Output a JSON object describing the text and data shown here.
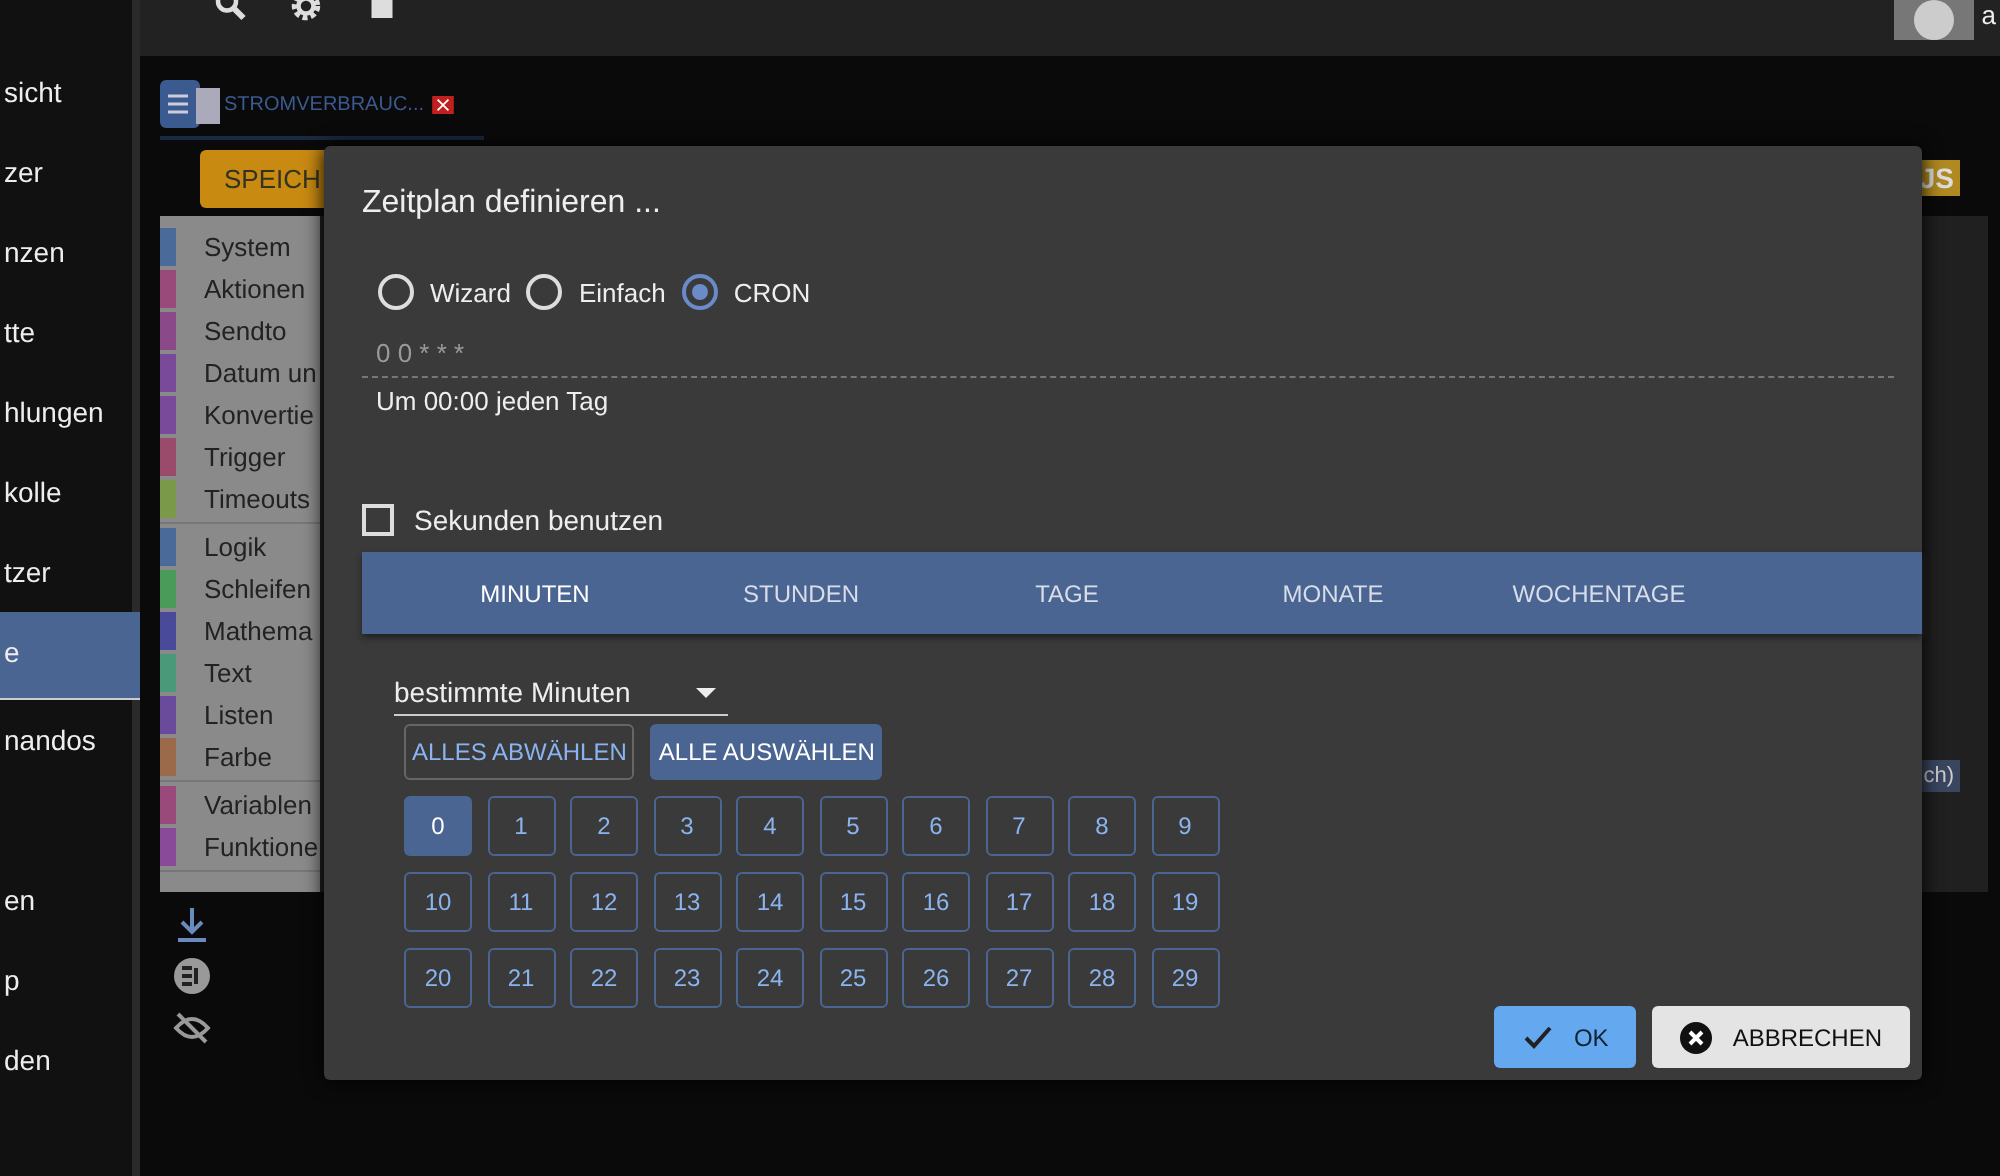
{
  "sidebar": {
    "items": [
      {
        "label": "sicht",
        "selected": false
      },
      {
        "label": "zer",
        "selected": false
      },
      {
        "label": "nzen",
        "selected": false
      },
      {
        "label": "tte",
        "selected": false
      },
      {
        "label": "hlungen",
        "selected": false
      },
      {
        "label": "kolle",
        "selected": false
      },
      {
        "label": "tzer",
        "selected": false
      },
      {
        "label": "e",
        "selected": true
      },
      {
        "label": "nandos",
        "selected": false
      },
      {
        "label": "en",
        "selected": false
      },
      {
        "label": "p",
        "selected": false
      },
      {
        "label": "den",
        "selected": false
      }
    ]
  },
  "user": {
    "name": "a"
  },
  "editor": {
    "tab_title": "STROMVERBRAUC...",
    "save_button": "SPEICH",
    "js_badge": "JS",
    "block_fragment": "ch)",
    "toolbox": [
      [
        {
          "label": "System",
          "color": "#4a6a9a"
        },
        {
          "label": "Aktionen",
          "color": "#9a4a7a"
        },
        {
          "label": "Sendto",
          "color": "#8a4a8a"
        },
        {
          "label": "Datum un",
          "color": "#7a4a9a"
        },
        {
          "label": "Konvertie",
          "color": "#7a4a9a"
        },
        {
          "label": "Trigger",
          "color": "#9a4a6a"
        },
        {
          "label": "Timeouts",
          "color": "#7a9a4a"
        }
      ],
      [
        {
          "label": "Logik",
          "color": "#4a6a9a"
        },
        {
          "label": "Schleifen",
          "color": "#4a9a5a"
        },
        {
          "label": "Mathema",
          "color": "#4a4a9a"
        },
        {
          "label": "Text",
          "color": "#4a9a7a"
        },
        {
          "label": "Listen",
          "color": "#6a4a9a"
        },
        {
          "label": "Farbe",
          "color": "#9a6a4a"
        }
      ],
      [
        {
          "label": "Variablen",
          "color": "#9a4a7a"
        },
        {
          "label": "Funktione",
          "color": "#8a4a9a"
        }
      ]
    ]
  },
  "dialog": {
    "title": "Zeitplan definieren ...",
    "modes": [
      {
        "label": "Wizard",
        "selected": false
      },
      {
        "label": "Einfach",
        "selected": false
      },
      {
        "label": "CRON",
        "selected": true
      }
    ],
    "cron_value": "0 0 * * *",
    "description": "Um 00:00 jeden Tag",
    "use_seconds": {
      "label": "Sekunden benutzen",
      "checked": false
    },
    "tabs": [
      {
        "label": "MINUTEN",
        "selected": true
      },
      {
        "label": "STUNDEN",
        "selected": false
      },
      {
        "label": "TAGE",
        "selected": false
      },
      {
        "label": "MONATE",
        "selected": false
      },
      {
        "label": "WOCHENTAGE",
        "selected": false
      }
    ],
    "mode_select": "bestimmte Minuten",
    "deselect_all": "ALLES ABWÄHLEN",
    "select_all": "ALLE AUSWÄHLEN",
    "minutes": [
      {
        "label": "0",
        "selected": true
      },
      {
        "label": "1",
        "selected": false
      },
      {
        "label": "2",
        "selected": false
      },
      {
        "label": "3",
        "selected": false
      },
      {
        "label": "4",
        "selected": false
      },
      {
        "label": "5",
        "selected": false
      },
      {
        "label": "6",
        "selected": false
      },
      {
        "label": "7",
        "selected": false
      },
      {
        "label": "8",
        "selected": false
      },
      {
        "label": "9",
        "selected": false
      },
      {
        "label": "10",
        "selected": false
      },
      {
        "label": "11",
        "selected": false
      },
      {
        "label": "12",
        "selected": false
      },
      {
        "label": "13",
        "selected": false
      },
      {
        "label": "14",
        "selected": false
      },
      {
        "label": "15",
        "selected": false
      },
      {
        "label": "16",
        "selected": false
      },
      {
        "label": "17",
        "selected": false
      },
      {
        "label": "18",
        "selected": false
      },
      {
        "label": "19",
        "selected": false
      },
      {
        "label": "20",
        "selected": false
      },
      {
        "label": "21",
        "selected": false
      },
      {
        "label": "22",
        "selected": false
      },
      {
        "label": "23",
        "selected": false
      },
      {
        "label": "24",
        "selected": false
      },
      {
        "label": "25",
        "selected": false
      },
      {
        "label": "26",
        "selected": false
      },
      {
        "label": "27",
        "selected": false
      },
      {
        "label": "28",
        "selected": false
      },
      {
        "label": "29",
        "selected": false
      }
    ],
    "ok": "OK",
    "cancel": "ABBRECHEN"
  }
}
